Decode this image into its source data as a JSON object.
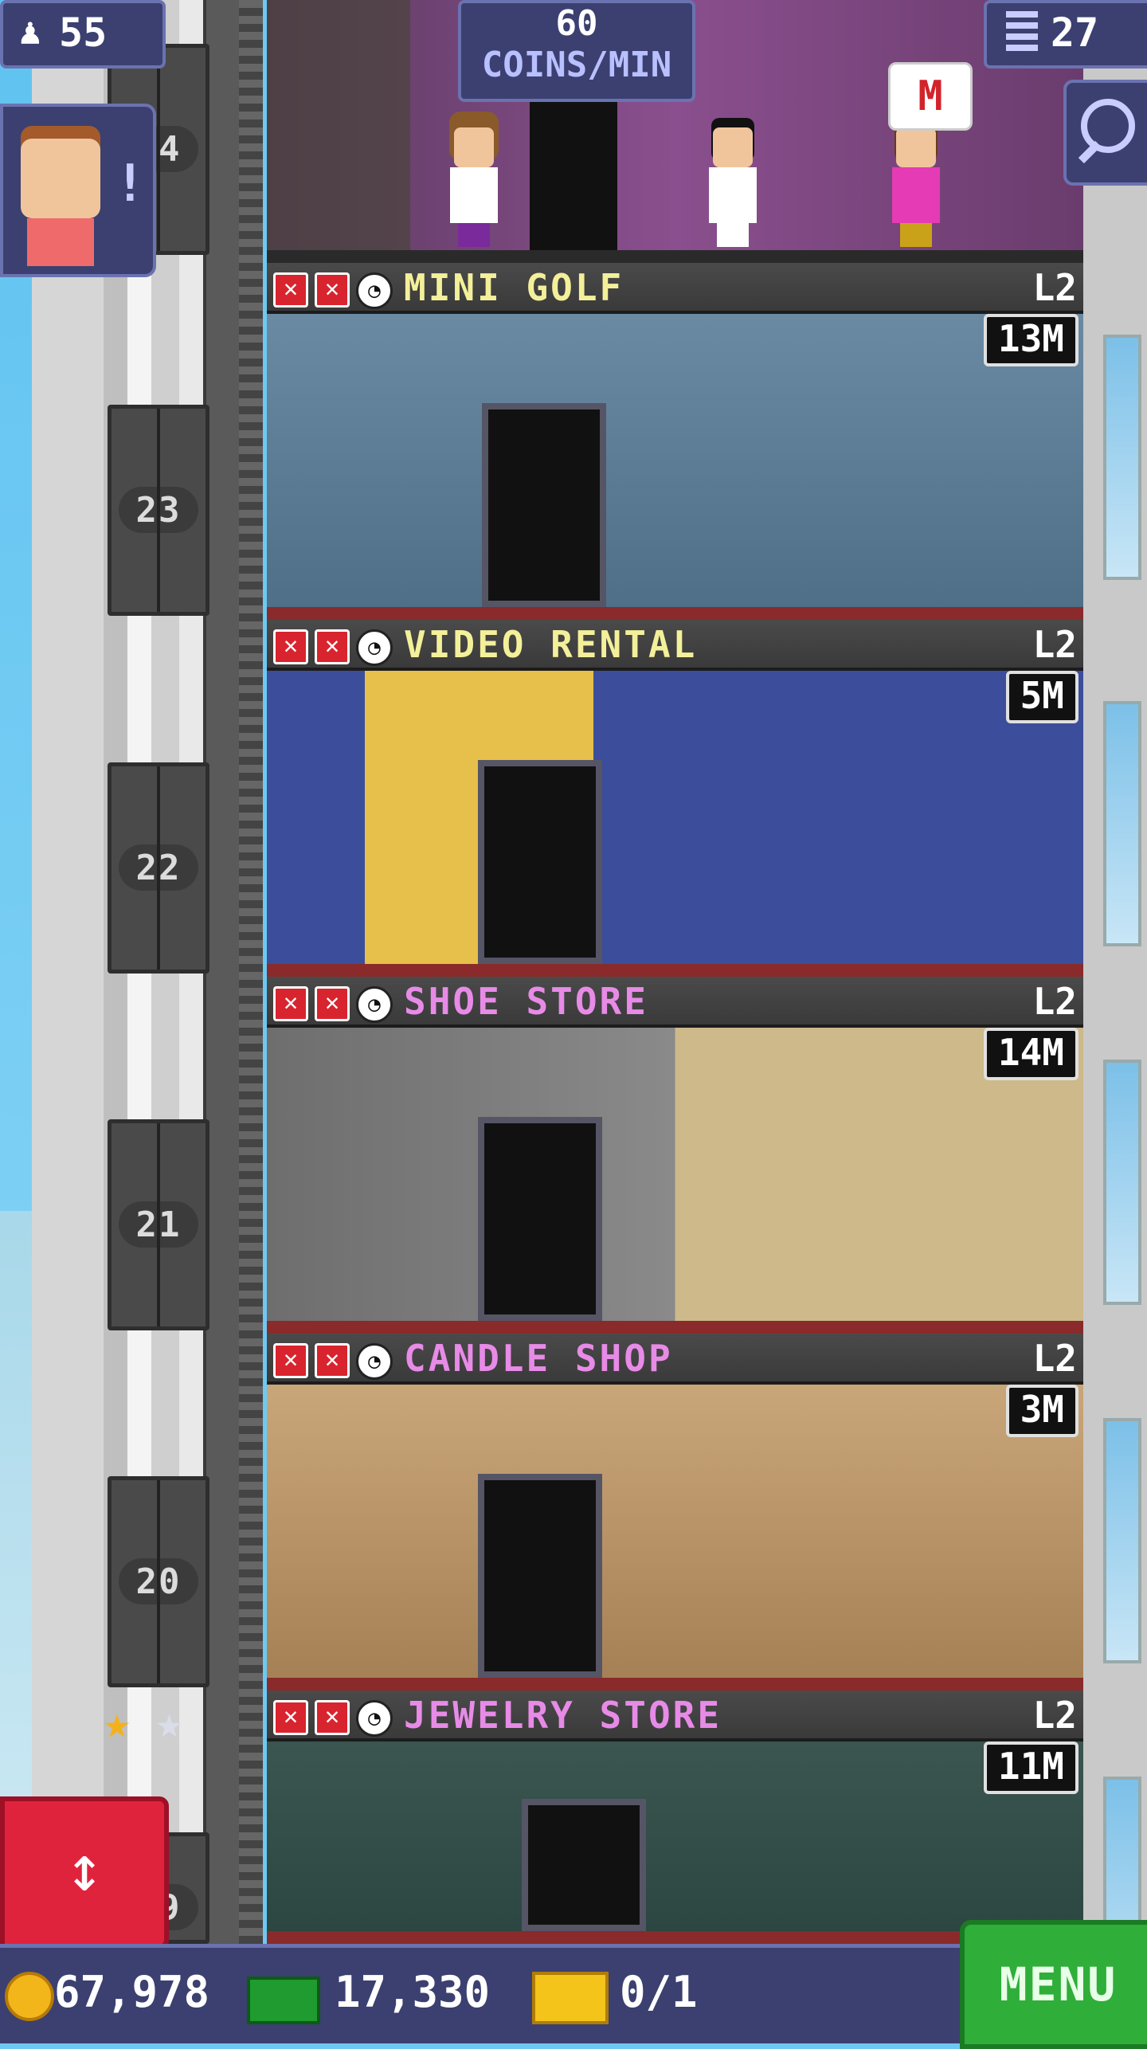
{
  "hud": {
    "population": "55",
    "coins_rate_value": "60",
    "coins_rate_unit": "COINS/MIN",
    "floor_count": "27"
  },
  "bottom_bar": {
    "coins": "67,978",
    "bux": "17,330",
    "tickets": "0/1",
    "menu_label": "MENU"
  },
  "elevator": {
    "floor_labels": [
      "24",
      "23",
      "22",
      "21",
      "20",
      "19"
    ]
  },
  "floors": [
    {
      "name": "MINI GOLF",
      "level": "L2",
      "stock": "13M",
      "name_color": "#f4f09a"
    },
    {
      "name": "VIDEO RENTAL",
      "level": "L2",
      "stock": "5M",
      "name_color": "#f4f09a"
    },
    {
      "name": "SHOE STORE",
      "level": "L2",
      "stock": "14M",
      "name_color": "#e78be7"
    },
    {
      "name": "CANDLE SHOP",
      "level": "L2",
      "stock": "3M",
      "name_color": "#e78be7"
    },
    {
      "name": "JEWELRY STORE",
      "level": "L2",
      "stock": "11M",
      "name_color": "#e78be7"
    }
  ],
  "icons": {
    "header_status": [
      "x-icon",
      "x-icon",
      "clock-icon"
    ],
    "notify_badge": "!",
    "mail_bubble": "M",
    "elevator_control": "↕"
  },
  "colors": {
    "hud_bg": "#3b4070",
    "menu_green": "#2fae3a",
    "elevator_red": "#e0233d"
  }
}
